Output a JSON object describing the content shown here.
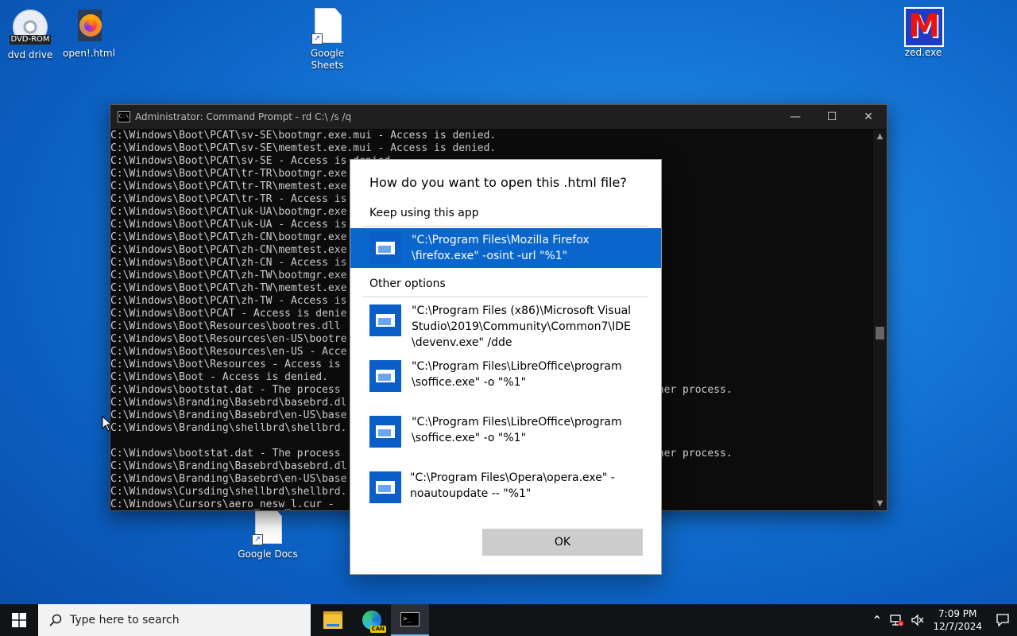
{
  "desktop": {
    "icons": [
      {
        "label": "dvd drive",
        "badge": "DVD-ROM",
        "icon": "dvd-drive-icon"
      },
      {
        "label": "open!.html",
        "icon": "firefox-html-icon"
      },
      {
        "label": "Google Sheets",
        "icon": "document-shortcut-icon"
      },
      {
        "label": "zed.exe",
        "icon": "zed-m-icon"
      },
      {
        "label": "Google Docs",
        "icon": "document-shortcut-icon"
      }
    ]
  },
  "cmd": {
    "title": "Administrator: Command Prompt - rd  C:\\ /s /q",
    "icon_text": "C:\\",
    "lines": [
      "C:\\Windows\\Boot\\PCAT\\sv-SE\\bootmgr.exe.mui - Access is denied.",
      "C:\\Windows\\Boot\\PCAT\\sv-SE\\memtest.exe.mui - Access is denied.",
      "C:\\Windows\\Boot\\PCAT\\sv-SE - Access is denied.",
      "C:\\Windows\\Boot\\PCAT\\tr-TR\\bootmgr.exe",
      "C:\\Windows\\Boot\\PCAT\\tr-TR\\memtest.exe",
      "C:\\Windows\\Boot\\PCAT\\tr-TR - Access is",
      "C:\\Windows\\Boot\\PCAT\\uk-UA\\bootmgr.exe",
      "C:\\Windows\\Boot\\PCAT\\uk-UA - Access is",
      "C:\\Windows\\Boot\\PCAT\\zh-CN\\bootmgr.exe",
      "C:\\Windows\\Boot\\PCAT\\zh-CN\\memtest.exe",
      "C:\\Windows\\Boot\\PCAT\\zh-CN - Access is",
      "C:\\Windows\\Boot\\PCAT\\zh-TW\\bootmgr.exe",
      "C:\\Windows\\Boot\\PCAT\\zh-TW\\memtest.exe",
      "C:\\Windows\\Boot\\PCAT\\zh-TW - Access is",
      "C:\\Windows\\Boot\\PCAT - Access is denie",
      "C:\\Windows\\Boot\\Resources\\bootres.dll",
      "C:\\Windows\\Boot\\Resources\\en-US\\bootre",
      "C:\\Windows\\Boot\\Resources\\en-US - Acce",
      "C:\\Windows\\Boot\\Resources - Access is",
      "C:\\Windows\\Boot - Access is denied.",
      "C:\\Windows\\bootstat.dat - The process                                            by another process.",
      "C:\\Windows\\Branding\\Basebrd\\basebrd.dl",
      "C:\\Windows\\Branding\\Basebrd\\en-US\\base",
      "C:\\Windows\\Branding\\shellbrd\\shellbrd.",
      "",
      "C:\\Windows\\bootstat.dat - The process                                            by another process.",
      "C:\\Windows\\Branding\\Basebrd\\basebrd.dl",
      "C:\\Windows\\Branding\\Basebrd\\en-US\\base",
      "C:\\Windows\\Cursding\\shellbrd\\shellbrd.",
      "C:\\Windows\\Cursors\\aero_nesw_l.cur - "
    ],
    "controls": {
      "minimize": "—",
      "maximize": "☐",
      "close": "✕"
    }
  },
  "dialog": {
    "title": "How do you want to open this .html file?",
    "keep_label": "Keep using this app",
    "selected_option": "\"C:\\Program Files\\Mozilla Firefox\\firefox.exe\" -osint -url \"%1\"",
    "selected_lines": [
      "\"C:\\Program Files\\Mozilla Firefox",
      "\\firefox.exe\" -osint -url \"%1\""
    ],
    "other_label": "Other options",
    "options": [
      {
        "lines": [
          "\"C:\\Program Files (x86)\\Microsoft Visual",
          "Studio\\2019\\Community\\Common7\\IDE",
          "\\devenv.exe\" /dde"
        ]
      },
      {
        "lines": [
          "\"C:\\Program Files\\LibreOffice\\program",
          "\\soffice.exe\" -o \"%1\""
        ]
      },
      {
        "lines": [
          "\"C:\\Program Files\\LibreOffice\\program",
          "\\soffice.exe\" -o \"%1\""
        ]
      },
      {
        "lines": [
          "\"C:\\Program Files\\Opera\\opera.exe\" -",
          "noautoupdate -- \"%1\""
        ]
      }
    ],
    "ok_label": "OK"
  },
  "taskbar": {
    "search_placeholder": "Type here to search",
    "apps": [
      {
        "name": "file-explorer",
        "icon": "folder-icon"
      },
      {
        "name": "edge-canary",
        "icon": "edge-icon",
        "badge": "CAN"
      },
      {
        "name": "command-prompt",
        "icon": "cmd-icon",
        "active": true
      }
    ],
    "time": "7:09 PM",
    "date": "12/7/2024"
  },
  "colors": {
    "accent": "#0a66cc",
    "desktop": "#1678d8",
    "taskbar": "#101417",
    "cmd_bg": "#0c0c0c"
  }
}
